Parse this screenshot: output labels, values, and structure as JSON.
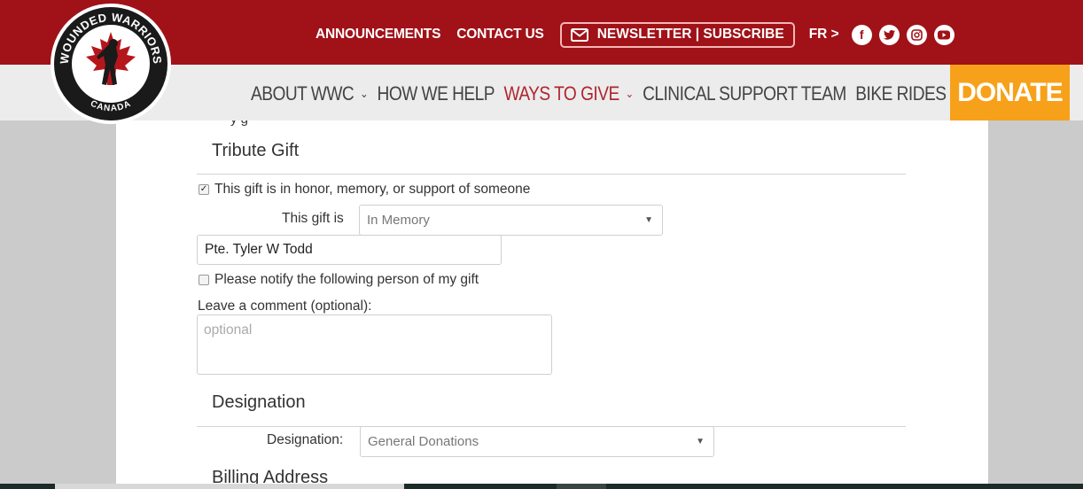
{
  "logo": {
    "text_top": "WOUNDED WARRIORS",
    "text_bottom": "CANADA"
  },
  "topnav": {
    "announcements": "ANNOUNCEMENTS",
    "contact": "CONTACT US",
    "newsletter": "NEWSLETTER | SUBSCRIBE",
    "language": "FR >",
    "social": [
      "facebook-icon",
      "twitter-icon",
      "instagram-icon",
      "youtube-icon"
    ]
  },
  "mainnav": {
    "items": [
      {
        "label": "ABOUT WWC",
        "dropdown": true
      },
      {
        "label": "HOW WE HELP",
        "dropdown": false
      },
      {
        "label": "WAYS TO GIVE",
        "dropdown": true,
        "active": true
      },
      {
        "label": "CLINICAL SUPPORT TEAM",
        "dropdown": false
      },
      {
        "label": "BIKE RIDES",
        "dropdown": false
      }
    ],
    "donate": "DONATE"
  },
  "form": {
    "partial_text": "y g",
    "tribute": {
      "title": "Tribute Gift",
      "honor_checkbox_label": "This gift is in honor, memory, or support of someone",
      "honor_checked": true,
      "gift_is_label": "This gift is",
      "gift_is_value": "In Memory",
      "honoree_name": "Pte. Tyler W Todd",
      "notify_checkbox_label": "Please notify the following person of my gift",
      "notify_checked": false,
      "comment_label": "Leave a comment (optional):",
      "comment_placeholder": "optional"
    },
    "designation": {
      "title": "Designation",
      "label": "Designation:",
      "value": "General Donations"
    },
    "billing": {
      "title": "Billing Address"
    }
  },
  "colors": {
    "brand_red": "#a01218",
    "nav_active": "#b0262f",
    "donate_orange": "#f7a11a"
  }
}
